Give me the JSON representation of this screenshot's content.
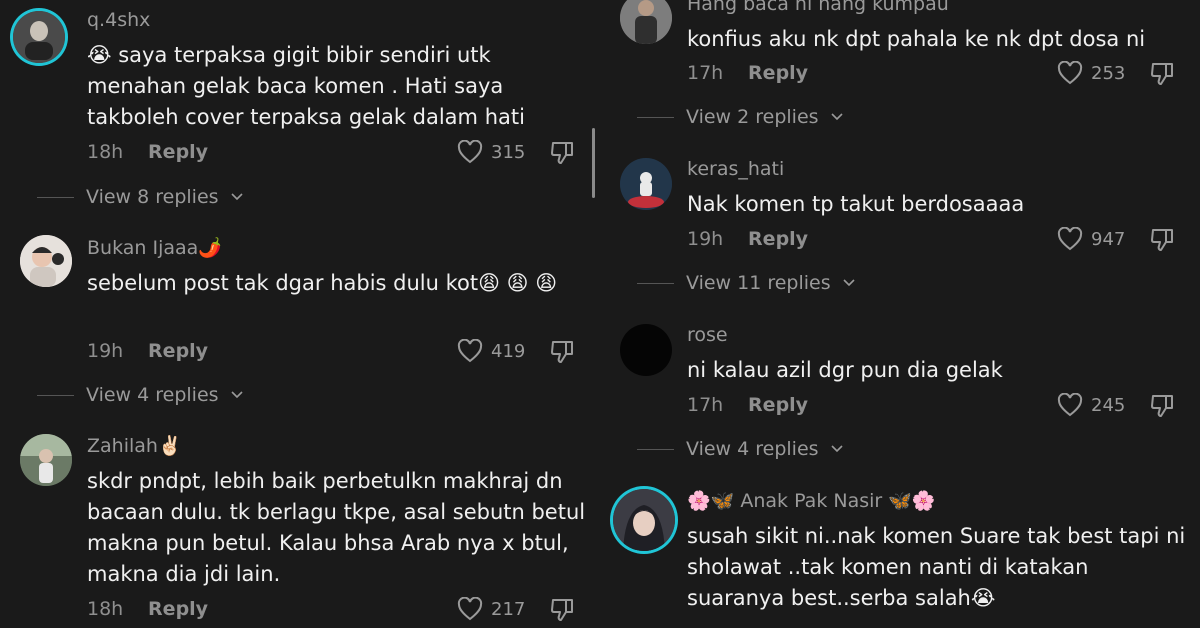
{
  "left_comments": [
    {
      "username": "q.4shx",
      "text": "😭 saya terpaksa gigit bibir sendiri utk menahan gelak baca komen . Hati saya takboleh cover terpaksa gelak dalam hati",
      "time": "18h",
      "reply": "Reply",
      "likes": "315",
      "view_replies": "View 8 replies"
    },
    {
      "username": "Bukan Ijaaa🌶️",
      "text": "sebelum post tak dgar habis dulu kot😩 😩 😩",
      "time": "19h",
      "reply": "Reply",
      "likes": "419",
      "view_replies": "View 4 replies"
    },
    {
      "username": "Zahilah✌🏻",
      "text": "skdr pndpt, lebih baik perbetulkn makhraj dn bacaan dulu. tk berlagu tkpe, asal sebutn betul makna pun betul. Kalau bhsa Arab nya x btul, makna dia jdi lain.",
      "time": "18h",
      "reply": "Reply",
      "likes": "217"
    }
  ],
  "right_comments": [
    {
      "username": "Hang baca ni hang kumpau",
      "text": "konfius aku nk dpt pahala ke nk dpt dosa ni",
      "time": "17h",
      "reply": "Reply",
      "likes": "253",
      "view_replies": "View 2 replies"
    },
    {
      "username": "keras_hati",
      "text": "Nak komen tp takut berdosaaaa",
      "time": "19h",
      "reply": "Reply",
      "likes": "947",
      "view_replies": "View 11 replies"
    },
    {
      "username": "rose",
      "text": "ni kalau azil dgr pun dia gelak",
      "time": "17h",
      "reply": "Reply",
      "likes": "245",
      "view_replies": "View 4 replies"
    },
    {
      "username": "🌸🦋 Anak Pak Nasir 🦋🌸",
      "text": "susah sikit ni..nak komen Suare tak best tapi ni sholawat ..tak komen nanti di katakan suaranya best..serba salah😭"
    }
  ],
  "colors": {
    "background": "#1a1a1a",
    "story_ring": "#20c5d6",
    "text_primary": "#f0f0f0",
    "text_secondary": "#9a9a9a"
  }
}
